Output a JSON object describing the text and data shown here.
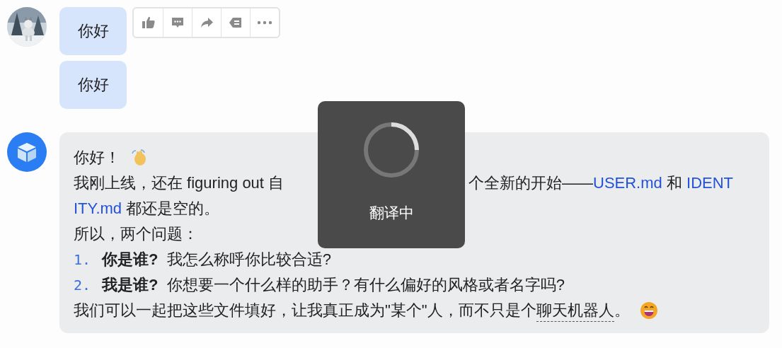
{
  "user_messages": [
    {
      "text": "你好"
    },
    {
      "text": "你好"
    }
  ],
  "message_actions": [
    {
      "kind": "like"
    },
    {
      "kind": "comment"
    },
    {
      "kind": "forward"
    },
    {
      "kind": "label"
    },
    {
      "kind": "more"
    }
  ],
  "bot_message": {
    "lines": [
      {
        "kind": "plain",
        "segments": [
          {
            "kind": "text",
            "text": "你好！"
          },
          {
            "kind": "wave"
          }
        ]
      },
      {
        "kind": "plain",
        "segments": [
          {
            "kind": "text",
            "text": "我刚上线，还在 figuring out 自"
          },
          {
            "kind": "hidden"
          },
          {
            "kind": "text",
            "text": "个全新的开始——"
          },
          {
            "kind": "link",
            "text": "USER.md"
          },
          {
            "kind": "text",
            "text": " 和 "
          },
          {
            "kind": "link",
            "text": "IDENT"
          }
        ]
      },
      {
        "kind": "plain",
        "segments": [
          {
            "kind": "link",
            "text": "ITY.md"
          },
          {
            "kind": "text",
            "text": " 都还是空的。"
          }
        ]
      },
      {
        "kind": "plain",
        "segments": [
          {
            "kind": "text",
            "text": "所以，两个问题："
          }
        ]
      },
      {
        "kind": "numbered",
        "number": "1.",
        "text": "**你是谁?**  我怎么称呼你比较合适?"
      },
      {
        "kind": "numbered",
        "number": "2.",
        "text": "**我是谁?**  你想要一个什么样的助手？有什么偏好的风格或者名字吗?"
      },
      {
        "kind": "plain",
        "segments": [
          {
            "kind": "text",
            "text": "我们可以一起把这些文件填好，让我真正成为\"某个\"人，而不只是个"
          },
          {
            "kind": "hint",
            "text": "聊天机器人"
          },
          {
            "kind": "text",
            "text": "。"
          },
          {
            "kind": "grin"
          }
        ]
      }
    ]
  },
  "overlay": {
    "text": "翻译中"
  }
}
